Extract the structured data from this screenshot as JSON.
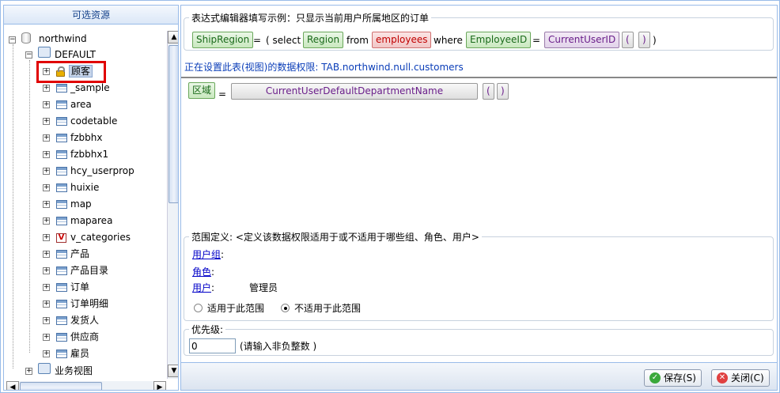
{
  "left_panel": {
    "title": "可选资源",
    "root": "northwind",
    "schema": "DEFAULT",
    "selected": "顾客",
    "items": [
      "_sample",
      "area",
      "codetable",
      "fzbbhx",
      "fzbbhx1",
      "hcy_userprop",
      "huixie",
      "map",
      "maparea",
      "v_categories",
      "产品",
      "产品目录",
      "订单",
      "订单明细",
      "发货人",
      "供应商",
      "雇员"
    ],
    "bottom": "业务视图"
  },
  "example": {
    "legend": "表达式编辑器填写示例：只显示当前用户所属地区的订单",
    "tok1": "ShipRegion",
    "eq": "=",
    "open": "( select",
    "tok2": "Region",
    "from": "from",
    "tok3": "employees",
    "where": "where",
    "tok4": "EmployeeID",
    "eq2": "=",
    "tok5": "CurrentUserID",
    "paren_l": "(",
    "paren_r": ")",
    "close": ")"
  },
  "info": "正在设置此表(视图)的数据权限: TAB.northwind.null.customers",
  "expr": {
    "field": "区域",
    "eq": "=",
    "func": "CurrentUserDefaultDepartmentName",
    "paren_l": "(",
    "paren_r": ")"
  },
  "scope": {
    "legend": "范围定义: <定义该数据权限适用于或不适用于哪些组、角色、用户>",
    "group_label": "用户组",
    "role_label": "角色",
    "user_label": "用户",
    "colon": ":",
    "user_value": "管理员",
    "opt_apply": "适用于此范围",
    "opt_not_apply": "不适用于此范围"
  },
  "priority": {
    "legend": "优先级:",
    "value": "0",
    "hint": "(请输入非负整数 )"
  },
  "buttons": {
    "save": "保存(S)",
    "close": "关闭(C)"
  },
  "colors": {
    "border": "#99bbe8",
    "highlight": "#e00000",
    "info_text": "#0a3db8"
  }
}
